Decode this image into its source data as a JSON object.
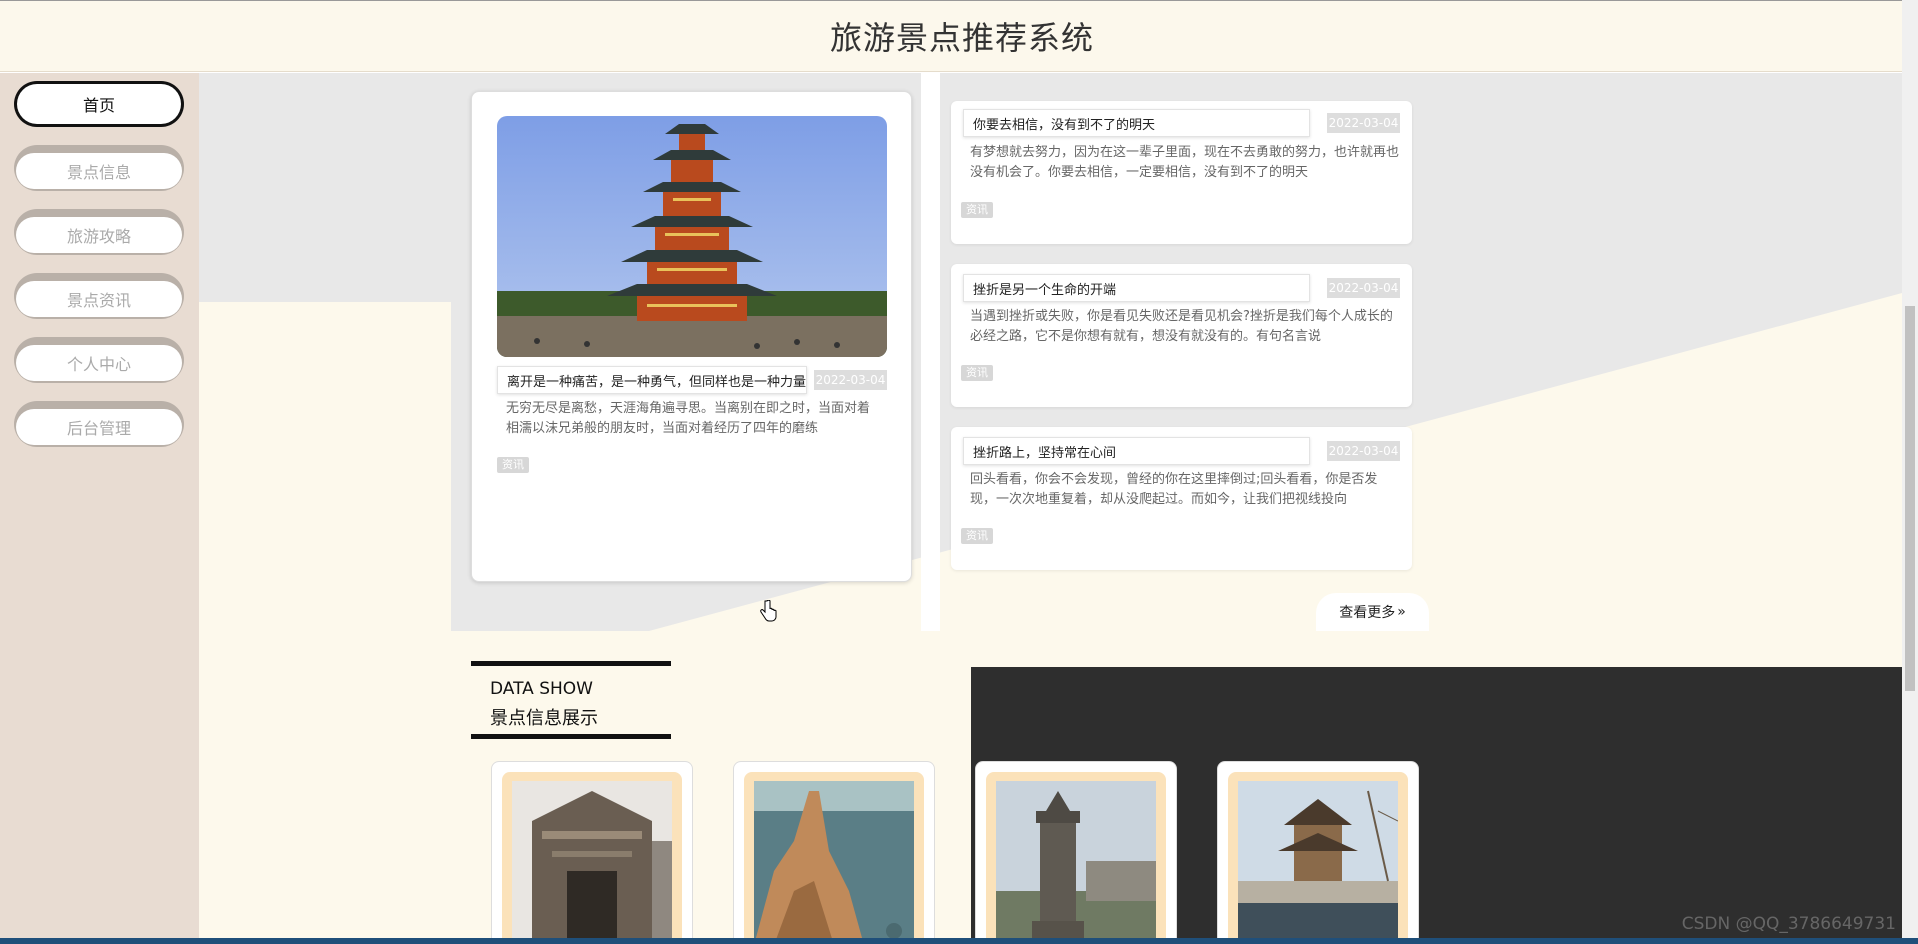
{
  "header": {
    "title": "旅游景点推荐系统"
  },
  "sidebar": {
    "items": [
      {
        "label": "首页"
      },
      {
        "label": "景点信息"
      },
      {
        "label": "旅游攻略"
      },
      {
        "label": "景点资讯"
      },
      {
        "label": "个人中心"
      },
      {
        "label": "后台管理"
      }
    ]
  },
  "featured": {
    "image_name": "yellow-crane-tower-photo",
    "title": "离开是一种痛苦，是一种勇气，但同样也是一种力量",
    "date": "2022-03-04",
    "excerpt": "无穷无尽是离愁，天涯海角遍寻思。当离别在即之时，当面对着相濡以沫兄弟般的朋友时，当面对着经历了四年的磨练",
    "tag": "资讯"
  },
  "news": [
    {
      "title": "你要去相信，没有到不了的明天",
      "date": "2022-03-04",
      "excerpt": "有梦想就去努力，因为在这一辈子里面，现在不去勇敢的努力，也许就再也没有机会了。你要去相信，一定要相信，没有到不了的明天",
      "tag": "资讯"
    },
    {
      "title": "挫折是另一个生命的开端",
      "date": "2022-03-04",
      "excerpt": "当遇到挫折或失败，你是看见失败还是看见机会?挫折是我们每个人成长的必经之路，它不是你想有就有，想没有就没有的。有句名言说",
      "tag": "资讯"
    },
    {
      "title": "挫折路上，坚持常在心间",
      "date": "2022-03-04",
      "excerpt": "回头看看，你会不会发现，曾经的你在这里摔倒过;回头看看，你是否发现，一次次地重复着，却从没爬起过。而如今，让我们把视线投向",
      "tag": "资讯"
    }
  ],
  "more_label": "查看更多",
  "more_icon": "double-chevron-right-icon",
  "data_show": {
    "en": "DATA SHOW",
    "cn": "景点信息展示",
    "cards": [
      {
        "image_name": "ancient-gate-photo"
      },
      {
        "image_name": "coastal-rock-photo"
      },
      {
        "image_name": "monument-city-photo"
      },
      {
        "image_name": "pavilion-lake-photo"
      }
    ]
  },
  "watermark": "CSDN @QQ_3786649731"
}
